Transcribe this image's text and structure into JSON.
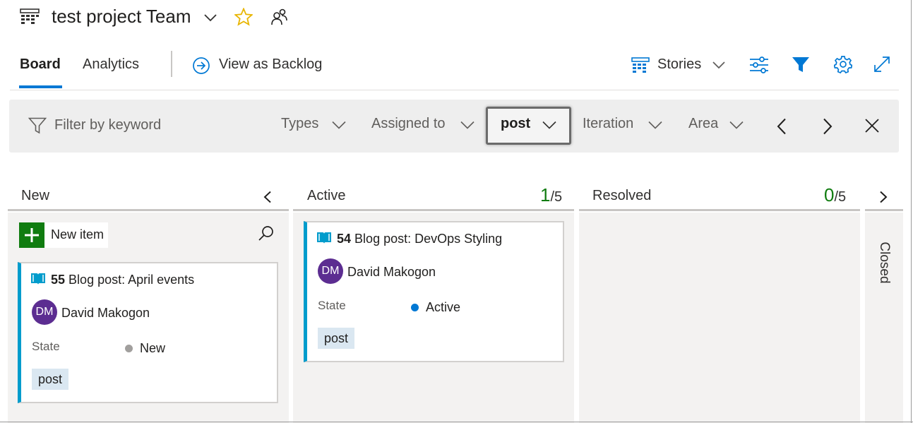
{
  "header": {
    "team_title": "test project Team",
    "icons": [
      "board-grid-icon",
      "chevron-down-icon",
      "star-icon",
      "team-members-icon"
    ]
  },
  "tabs": [
    {
      "label": "Board",
      "selected": true
    },
    {
      "label": "Analytics",
      "selected": false
    }
  ],
  "view_as_backlog": "View as Backlog",
  "backlog_level": "Stories",
  "toolbar_icons": [
    "board-grid-icon",
    "settings-sliders-icon",
    "filter-icon",
    "gear-icon",
    "expand-icon"
  ],
  "filter": {
    "keyword_placeholder": "Filter by keyword",
    "types": "Types",
    "assigned_to": "Assigned to",
    "tags": "post",
    "iteration": "Iteration",
    "area": "Area"
  },
  "columns": [
    {
      "name": "New"
    },
    {
      "name": "Active",
      "count": "1",
      "limit": "/5"
    },
    {
      "name": "Resolved",
      "count": "0",
      "limit": "/5"
    },
    {
      "name": "Closed"
    }
  ],
  "new_item_label": "New item",
  "cards": [
    {
      "id": "55",
      "title": "Blog post: April events",
      "assignee_initials": "DM",
      "assignee": "David Makogon",
      "state_label": "State",
      "state": "New",
      "state_color": "#a19f9d",
      "tag": "post"
    },
    {
      "id": "54",
      "title": "Blog post: DevOps Styling",
      "assignee_initials": "DM",
      "assignee": "David Makogon",
      "state_label": "State",
      "state": "Active",
      "state_color": "#0078d4",
      "tag": "post"
    }
  ],
  "colors": {
    "accent": "#0078d4",
    "story_blue": "#009ccc",
    "wip_green": "#107c10",
    "avatar_purple": "#5c2d91",
    "star_yellow": "#f2c811"
  }
}
